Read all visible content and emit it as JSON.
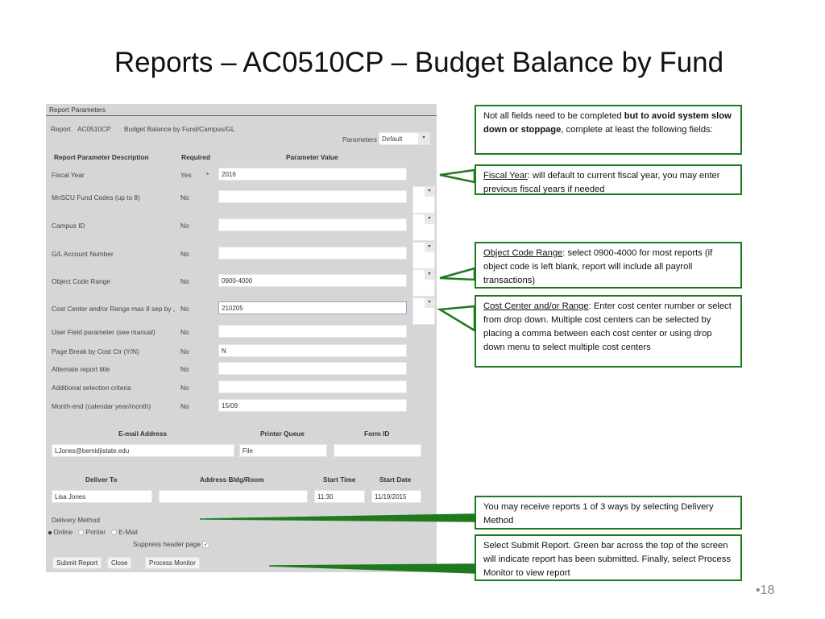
{
  "slide": {
    "title": "Reports – AC0510CP – Budget Balance by Fund",
    "page_number": "•18"
  },
  "panel": {
    "header": "Report Parameters",
    "report_label": "Report",
    "report_id": "AC0510CP",
    "report_name": "Budget Balance by Fund/Campus/GL",
    "parameters_label": "Parameters",
    "parameters_value": "Default",
    "columns": {
      "description": "Report Parameter Description",
      "required": "Required",
      "value": "Parameter Value"
    },
    "rows": [
      {
        "label": "Fiscal Year",
        "required": "Yes",
        "marker": "*",
        "value": ""
      },
      {
        "label": "MnSCU Fund Codes (up to 8)",
        "required": "No",
        "value": ""
      },
      {
        "label": "Campus ID",
        "required": "No",
        "value": ""
      },
      {
        "label": "G/L Account Number",
        "required": "No",
        "value": ""
      },
      {
        "label": "Object Code Range",
        "required": "No",
        "value": "0900-4000"
      },
      {
        "label": "Cost Center and/or Range max 8 sep by ,",
        "required": "No",
        "value": "210205"
      },
      {
        "label": "User Field parameter (see manual)",
        "required": "No",
        "value": ""
      },
      {
        "label": "Page Break by Cost Ctr (Y/N)",
        "required": "No",
        "value": "N"
      },
      {
        "label": "Alternate report title",
        "required": "No",
        "value": ""
      },
      {
        "label": "Additional selection criteria",
        "required": "No",
        "value": ""
      },
      {
        "label": "Month-end (calendar year/month)",
        "required": "No",
        "value": "15/09"
      }
    ],
    "fiscal_year_value": "2016",
    "dropdown_arrow": "▾",
    "email_header": "E-mail Address",
    "printer_header": "Printer Queue",
    "form_header": "Form ID",
    "email_value": "LJones@bemidjistate.edu",
    "printer_value": "File",
    "form_value": "",
    "deliver_header": "Deliver To",
    "address_header": "Address Bldg/Room",
    "start_time_header": "Start Time",
    "start_date_header": "Start Date",
    "deliver_value": "Lisa Jones",
    "address_value": "",
    "start_time_value": "11:30",
    "start_date_value": "11/19/2015",
    "delivery_method_label": "Delivery Method",
    "delivery_options": [
      "Online",
      "Printer",
      "E-Mail"
    ],
    "delivery_selected": "Online",
    "suppress_label": "Suppress header page",
    "suppress_checked": "✓",
    "buttons": {
      "submit": "Submit Report",
      "close": "Close",
      "process_monitor": "Process Monitor"
    }
  },
  "callouts": {
    "intro": {
      "text_a": "Not all fields need to be completed ",
      "bold": "but to avoid system slow down or stoppage",
      "text_b": ", complete at least the following fields:"
    },
    "fiscal_year": {
      "heading": "Fiscal Year",
      "text": ": will default to current fiscal year, you may enter previous fiscal years if needed"
    },
    "object_code": {
      "heading": "Object Code Range",
      "text": ": select 0900-4000 for most reports (if object code is left blank, report will include all payroll transactions)"
    },
    "cost_center": {
      "heading": "Cost Center and/or Range",
      "text": ": Enter cost center number or select from drop down.  Multiple cost centers can be selected by placing a comma between each cost center or using drop down menu to select multiple cost centers"
    },
    "delivery": {
      "text": "You may receive reports  1 of 3 ways by selecting Delivery Method"
    },
    "submit": {
      "text": "Select Submit Report.  Green bar across the top of the screen will indicate report has been submitted.  Finally, select Process Monitor to view report"
    }
  },
  "colors": {
    "callout_border": "#1f7a1f",
    "panel_bg": "#d6d6d6"
  }
}
